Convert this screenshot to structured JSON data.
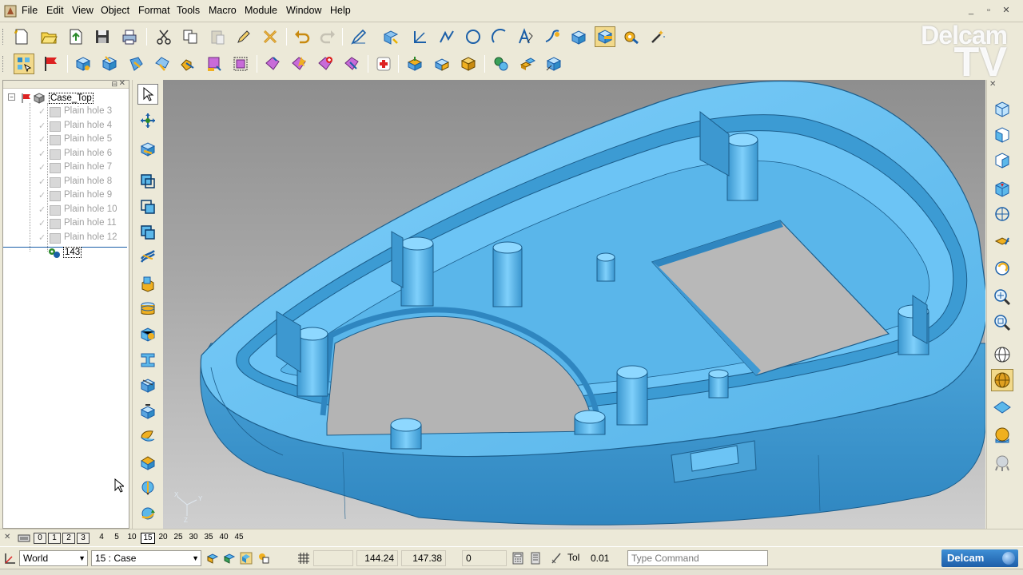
{
  "menu": [
    "File",
    "Edit",
    "View",
    "Object",
    "Format",
    "Tools",
    "Macro",
    "Module",
    "Window",
    "Help"
  ],
  "window_controls": {
    "minimize": "_",
    "restore": "▫",
    "close": "✕"
  },
  "logo": {
    "line1": "Delcam",
    "line2": "TV"
  },
  "toolbar1": [
    "new-icon",
    "open-icon",
    "import-icon",
    "save-icon",
    "print-icon",
    "cut-icon",
    "copy-icon",
    "paste-icon",
    "edit-icon",
    "delete-icon",
    "undo-icon",
    "redo-icon",
    "sketch-icon",
    "transform-icon",
    "line-icon",
    "polyline-icon",
    "circle-icon",
    "arc-icon",
    "text-icon",
    "curve-icon",
    "solid-icon",
    "feature-icon",
    "settings-icon",
    "wizard-icon"
  ],
  "toolbar2": [
    "select-icon",
    "flag-icon",
    "solid-tree-icon",
    "extrude-icon",
    "revolve-icon",
    "sweep-icon",
    "fillet-icon",
    "boolean-icon",
    "primitive-icon",
    "feature-add-icon",
    "feature-remove-icon",
    "feature-edit-icon",
    "health-icon",
    "transform-icon",
    "shell-icon",
    "box-icon",
    "pattern-icon",
    "mirror-icon",
    "split-icon"
  ],
  "tree": {
    "root": "Case_Top",
    "items": [
      "Plain hole 3",
      "Plain hole 4",
      "Plain hole 5",
      "Plain hole 6",
      "Plain hole 7",
      "Plain hole 8",
      "Plain hole 9",
      "Plain hole 10",
      "Plain hole 11",
      "Plain hole 12"
    ],
    "selected": "143"
  },
  "sidebar": [
    "pointer-icon",
    "move-view-icon",
    "edit-feature-icon",
    "solid-new-icon",
    "copy-solid-icon",
    "paste-solid-icon",
    "twist-icon",
    "block-icon",
    "cylinder-icon",
    "cone-icon",
    "i-beam-icon",
    "box-solid-icon",
    "offset-icon",
    "shell-icon",
    "split-icon",
    "wedge-icon",
    "rotate-icon"
  ],
  "viewbar": [
    "view-top-icon",
    "view-front-icon",
    "view-side-icon",
    "view-iso-icon",
    "view-rotate-icon",
    "view-spin-icon",
    "view-undo-icon",
    "zoom-fit-icon",
    "zoom-window-icon",
    "wireframe-icon",
    "shaded-icon",
    "plane-icon",
    "lighting-icon",
    "render-icon"
  ],
  "layers": {
    "boxed": [
      "0",
      "1",
      "2",
      "3"
    ],
    "numbers": [
      "4",
      "5",
      "10",
      "15",
      "20",
      "25",
      "30",
      "35",
      "40",
      "45"
    ],
    "active": "15"
  },
  "status": {
    "workplane": "World",
    "level": "15 : Case",
    "x": "144.24",
    "y": "147.38",
    "z": "0",
    "tol_label": "Tol",
    "tol": "0.01",
    "command_placeholder": "Type Command",
    "brand": "Delcam"
  },
  "colors": {
    "part": "#5cb8ea",
    "part_dark": "#2f8bc6",
    "accent": "#f2d98a"
  }
}
